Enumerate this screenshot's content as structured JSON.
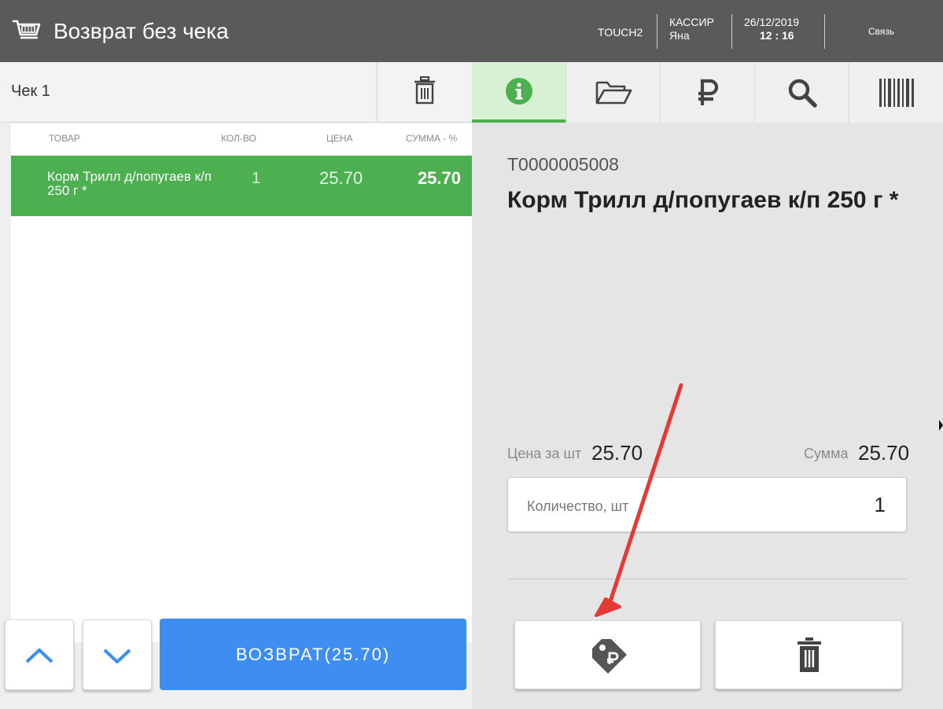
{
  "header": {
    "title": "Возврат без чека",
    "terminal": "TOUCH2",
    "cashier_label": "КАССИР",
    "cashier_name": "Яна",
    "date": "26/12/2019",
    "time": "12 : 16",
    "link": "Связь"
  },
  "receipt": {
    "tab_label": "Чек 1",
    "columns": [
      "ТОВАР",
      "КОЛ-ВО",
      "ЦЕНА",
      "СУММА - %"
    ],
    "items": [
      {
        "name": "Корм Трилл д/попугаев к/п 250 г *",
        "qty": "1",
        "price": "25.70",
        "sum": "25.70"
      }
    ]
  },
  "actions": {
    "return_label": "ВОЗВРАТ(25.70)"
  },
  "detail": {
    "sku": "T0000005008",
    "name": "Корм Трилл д/попугаев к/п 250 г *",
    "unit_price_label": "Цена за шт",
    "unit_price": "25.70",
    "sum_label": "Сумма",
    "sum": "25.70",
    "qty_placeholder": "Количество, шт",
    "qty_value": "1"
  },
  "tabs": [
    "info-icon",
    "folder-icon",
    "ruble-icon",
    "search-icon",
    "barcode-icon"
  ],
  "colors": {
    "header_bg": "#5a5a5a",
    "accent_green": "#4caf50",
    "return_blue": "#3d8ef0",
    "arrow_blue": "#3d8ef0",
    "annotation_red": "#e53935"
  }
}
